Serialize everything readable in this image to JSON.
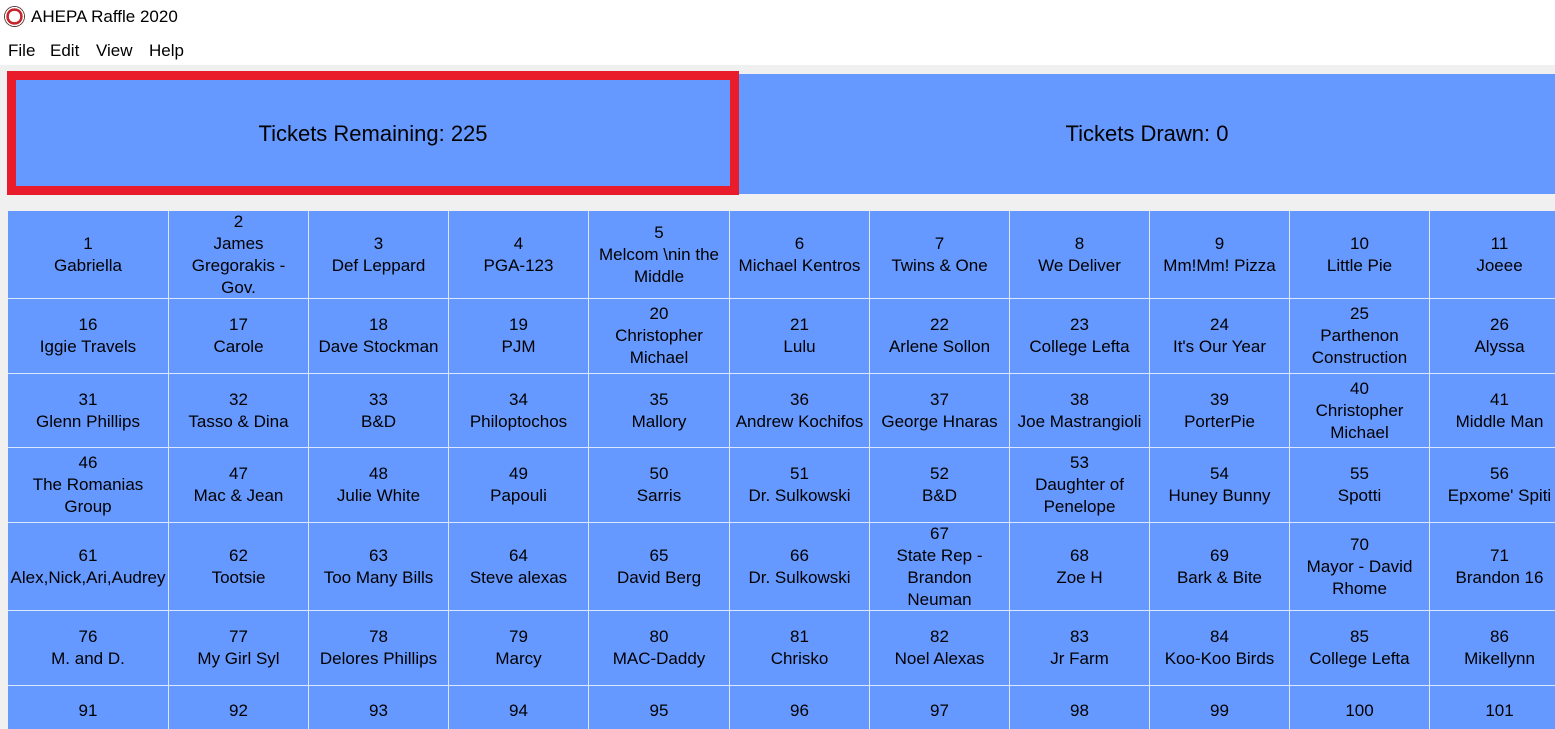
{
  "window": {
    "title": "AHEPA Raffle 2020",
    "icon": "ahepa-seal-icon"
  },
  "menu": [
    "File",
    "Edit",
    "View",
    "Help"
  ],
  "stats": {
    "remaining_label": "Tickets Remaining: 225",
    "drawn_label": "Tickets Drawn: 0"
  },
  "colors": {
    "panel": "#6699ff",
    "highlight": "#e81c2b"
  },
  "tickets": [
    [
      {
        "n": "1",
        "name": [
          "Gabriella"
        ]
      },
      {
        "n": "2",
        "name": [
          "James",
          "Gregorakis -",
          "Gov."
        ]
      },
      {
        "n": "3",
        "name": [
          "Def Leppard"
        ]
      },
      {
        "n": "4",
        "name": [
          "PGA-123"
        ]
      },
      {
        "n": "5",
        "name": [
          "Melcom \\nin the",
          "Middle"
        ]
      },
      {
        "n": "6",
        "name": [
          "Michael Kentros"
        ]
      },
      {
        "n": "7",
        "name": [
          "Twins & One"
        ]
      },
      {
        "n": "8",
        "name": [
          "We Deliver"
        ]
      },
      {
        "n": "9",
        "name": [
          "Mm!Mm! Pizza"
        ]
      },
      {
        "n": "10",
        "name": [
          "Little Pie"
        ]
      },
      {
        "n": "11",
        "name": [
          "Joeee"
        ]
      }
    ],
    [
      {
        "n": "16",
        "name": [
          "Iggie Travels"
        ]
      },
      {
        "n": "17",
        "name": [
          "Carole"
        ]
      },
      {
        "n": "18",
        "name": [
          "Dave Stockman"
        ]
      },
      {
        "n": "19",
        "name": [
          "PJM"
        ]
      },
      {
        "n": "20",
        "name": [
          "Christopher",
          "Michael"
        ]
      },
      {
        "n": "21",
        "name": [
          "Lulu"
        ]
      },
      {
        "n": "22",
        "name": [
          "Arlene Sollon"
        ]
      },
      {
        "n": "23",
        "name": [
          "College Lefta"
        ]
      },
      {
        "n": "24",
        "name": [
          "It's Our Year"
        ]
      },
      {
        "n": "25",
        "name": [
          "Parthenon",
          "Construction"
        ]
      },
      {
        "n": "26",
        "name": [
          "Alyssa"
        ]
      }
    ],
    [
      {
        "n": "31",
        "name": [
          "Glenn Phillips"
        ]
      },
      {
        "n": "32",
        "name": [
          "Tasso & Dina"
        ]
      },
      {
        "n": "33",
        "name": [
          "B&D"
        ]
      },
      {
        "n": "34",
        "name": [
          "Philoptochos"
        ]
      },
      {
        "n": "35",
        "name": [
          "Mallory"
        ]
      },
      {
        "n": "36",
        "name": [
          "Andrew Kochifos"
        ]
      },
      {
        "n": "37",
        "name": [
          "George Hnaras"
        ]
      },
      {
        "n": "38",
        "name": [
          "Joe Mastrangioli"
        ]
      },
      {
        "n": "39",
        "name": [
          "PorterPie"
        ]
      },
      {
        "n": "40",
        "name": [
          "Christopher",
          "Michael"
        ]
      },
      {
        "n": "41",
        "name": [
          "Middle Man"
        ]
      }
    ],
    [
      {
        "n": "46",
        "name": [
          "The Romanias",
          "Group"
        ]
      },
      {
        "n": "47",
        "name": [
          "Mac & Jean"
        ]
      },
      {
        "n": "48",
        "name": [
          "Julie White"
        ]
      },
      {
        "n": "49",
        "name": [
          "Papouli"
        ]
      },
      {
        "n": "50",
        "name": [
          "Sarris"
        ]
      },
      {
        "n": "51",
        "name": [
          "Dr. Sulkowski"
        ]
      },
      {
        "n": "52",
        "name": [
          "B&D"
        ]
      },
      {
        "n": "53",
        "name": [
          "Daughter of",
          "Penelope"
        ]
      },
      {
        "n": "54",
        "name": [
          "Huney Bunny"
        ]
      },
      {
        "n": "55",
        "name": [
          "Spotti"
        ]
      },
      {
        "n": "56",
        "name": [
          "Epxome' Spiti"
        ]
      }
    ],
    [
      {
        "n": "61",
        "name": [
          "Alex,Nick,Ari,Audrey"
        ]
      },
      {
        "n": "62",
        "name": [
          "Tootsie"
        ]
      },
      {
        "n": "63",
        "name": [
          "Too Many Bills"
        ]
      },
      {
        "n": "64",
        "name": [
          "Steve alexas"
        ]
      },
      {
        "n": "65",
        "name": [
          "David Berg"
        ]
      },
      {
        "n": "66",
        "name": [
          "Dr. Sulkowski"
        ]
      },
      {
        "n": "67",
        "name": [
          "State Rep -",
          "Brandon",
          "Neuman"
        ]
      },
      {
        "n": "68",
        "name": [
          "Zoe H"
        ]
      },
      {
        "n": "69",
        "name": [
          "Bark & Bite"
        ]
      },
      {
        "n": "70",
        "name": [
          "Mayor - David",
          "Rhome"
        ]
      },
      {
        "n": "71",
        "name": [
          "Brandon 16"
        ]
      }
    ],
    [
      {
        "n": "76",
        "name": [
          "M. and D."
        ]
      },
      {
        "n": "77",
        "name": [
          "My Girl Syl"
        ]
      },
      {
        "n": "78",
        "name": [
          "Delores Phillips"
        ]
      },
      {
        "n": "79",
        "name": [
          "Marcy"
        ]
      },
      {
        "n": "80",
        "name": [
          "MAC-Daddy"
        ]
      },
      {
        "n": "81",
        "name": [
          "Chrisko"
        ]
      },
      {
        "n": "82",
        "name": [
          "Noel Alexas"
        ]
      },
      {
        "n": "83",
        "name": [
          "Jr Farm"
        ]
      },
      {
        "n": "84",
        "name": [
          "Koo-Koo Birds"
        ]
      },
      {
        "n": "85",
        "name": [
          "College Lefta"
        ]
      },
      {
        "n": "86",
        "name": [
          "Mikellynn"
        ]
      }
    ],
    [
      {
        "n": "91",
        "name": []
      },
      {
        "n": "92",
        "name": []
      },
      {
        "n": "93",
        "name": []
      },
      {
        "n": "94",
        "name": []
      },
      {
        "n": "95",
        "name": []
      },
      {
        "n": "96",
        "name": []
      },
      {
        "n": "97",
        "name": []
      },
      {
        "n": "98",
        "name": []
      },
      {
        "n": "99",
        "name": []
      },
      {
        "n": "100",
        "name": []
      },
      {
        "n": "101",
        "name": []
      }
    ]
  ]
}
